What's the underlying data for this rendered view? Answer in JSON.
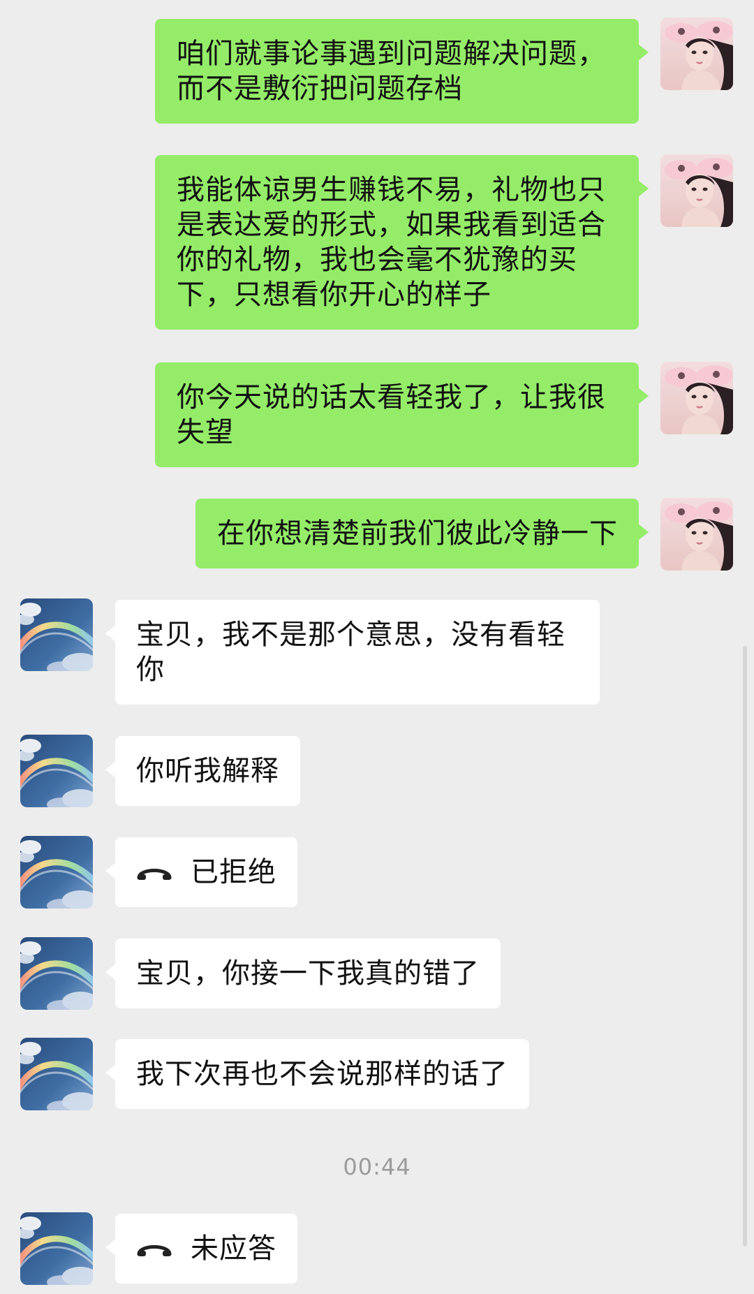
{
  "messages": [
    {
      "text": "咱们就事论事遇到问题解决问题，而不是敷衍把问题存档"
    },
    {
      "text": "我能体谅男生赚钱不易，礼物也只是表达爱的形式，如果我看到适合你的礼物，我也会毫不犹豫的买下，只想看你开心的样子"
    },
    {
      "text": "你今天说的话太看轻我了，让我很失望"
    },
    {
      "text": "在你想清楚前我们彼此冷静一下"
    },
    {
      "text": "宝贝，我不是那个意思，没有看轻你"
    },
    {
      "text": "你听我解释"
    },
    {
      "text": "已拒绝",
      "icon": "phone-hangup-icon"
    },
    {
      "text": "宝贝，你接一下我真的错了"
    },
    {
      "text": "我下次再也不会说那样的话了"
    },
    {
      "text": "未应答",
      "icon": "phone-hangup-icon"
    }
  ],
  "timestamp": "00:44",
  "colors": {
    "background": "#ededed",
    "sent_bubble": "#95ec69",
    "received_bubble": "#ffffff",
    "timestamp_text": "#9b9b9b"
  }
}
